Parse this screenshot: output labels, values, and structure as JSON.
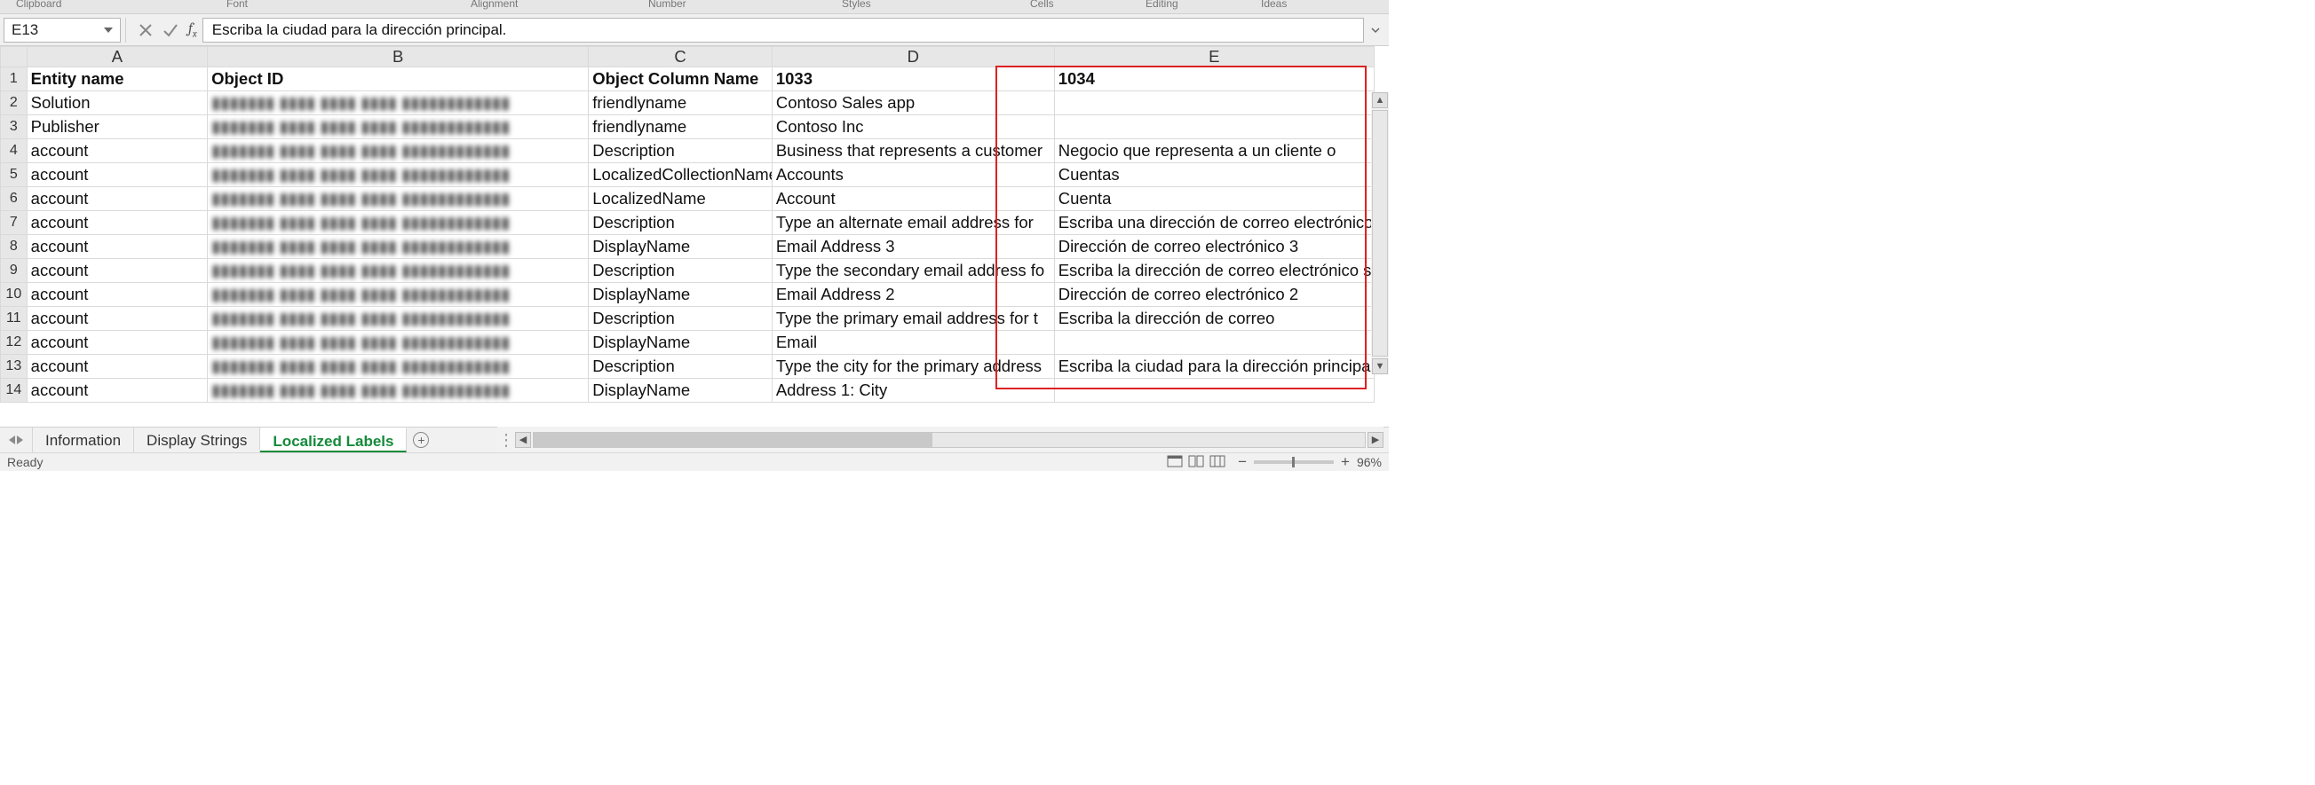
{
  "ribbon_groups": [
    "Clipboard",
    "Font",
    "",
    "Alignment",
    "",
    "Number",
    "",
    "Styles",
    "Cells",
    "Editing",
    "Ideas"
  ],
  "namebox": "E13",
  "formula_text": "Escriba la ciudad para la dirección principal.",
  "columns": [
    "A",
    "B",
    "C",
    "D",
    "E"
  ],
  "headers": {
    "A": "Entity name",
    "B": "Object ID",
    "C": "Object Column Name",
    "D": "1033",
    "E": "1034"
  },
  "rows": [
    {
      "n": "1",
      "A": "Entity name",
      "B": "Object ID",
      "C": "Object Column Name",
      "D": "1033",
      "E": "1034",
      "bold": true
    },
    {
      "n": "2",
      "A": "Solution",
      "B": "",
      "C": "friendlyname",
      "D": "Contoso Sales app",
      "E": ""
    },
    {
      "n": "3",
      "A": "Publisher",
      "B": "",
      "C": "friendlyname",
      "D": "Contoso Inc",
      "E": ""
    },
    {
      "n": "4",
      "A": "account",
      "B": "",
      "C": "Description",
      "D": "Business that represents a customer",
      "E": "Negocio que representa a un cliente o"
    },
    {
      "n": "5",
      "A": "account",
      "B": "",
      "C": "LocalizedCollectionName",
      "D": "Accounts",
      "E": "Cuentas"
    },
    {
      "n": "6",
      "A": "account",
      "B": "",
      "C": "LocalizedName",
      "D": "Account",
      "E": "Cuenta"
    },
    {
      "n": "7",
      "A": "account",
      "B": "",
      "C": "Description",
      "D": "Type an alternate email address for",
      "E": "Escriba una dirección de correo electrónico"
    },
    {
      "n": "8",
      "A": "account",
      "B": "",
      "C": "DisplayName",
      "D": "Email Address 3",
      "E": "Dirección de correo electrónico 3"
    },
    {
      "n": "9",
      "A": "account",
      "B": "",
      "C": "Description",
      "D": "Type the secondary email address fo",
      "E": "Escriba la dirección de correo electrónico s"
    },
    {
      "n": "10",
      "A": "account",
      "B": "",
      "C": "DisplayName",
      "D": "Email Address 2",
      "E": "Dirección de correo electrónico 2"
    },
    {
      "n": "11",
      "A": "account",
      "B": "",
      "C": "Description",
      "D": "Type the primary email address for t",
      "E": "Escriba la dirección de correo"
    },
    {
      "n": "12",
      "A": "account",
      "B": "",
      "C": "DisplayName",
      "D": "Email",
      "E": ""
    },
    {
      "n": "13",
      "A": "account",
      "B": "",
      "C": "Description",
      "D": "Type the city for the primary address",
      "E": "Escriba la ciudad para la dirección principa"
    },
    {
      "n": "14",
      "A": "account",
      "B": "",
      "C": "DisplayName",
      "D": "Address 1: City",
      "E": ""
    }
  ],
  "obj_id_placeholder": "▮▮▮▮▮▮▮ ▮▮▮▮ ▮▮▮▮ ▮▮▮▮ ▮▮▮▮▮▮▮▮▮▮▮▮",
  "tabs": {
    "items": [
      "Information",
      "Display Strings",
      "Localized Labels"
    ],
    "active": 2
  },
  "status": {
    "ready": "Ready",
    "zoom": "96%"
  }
}
